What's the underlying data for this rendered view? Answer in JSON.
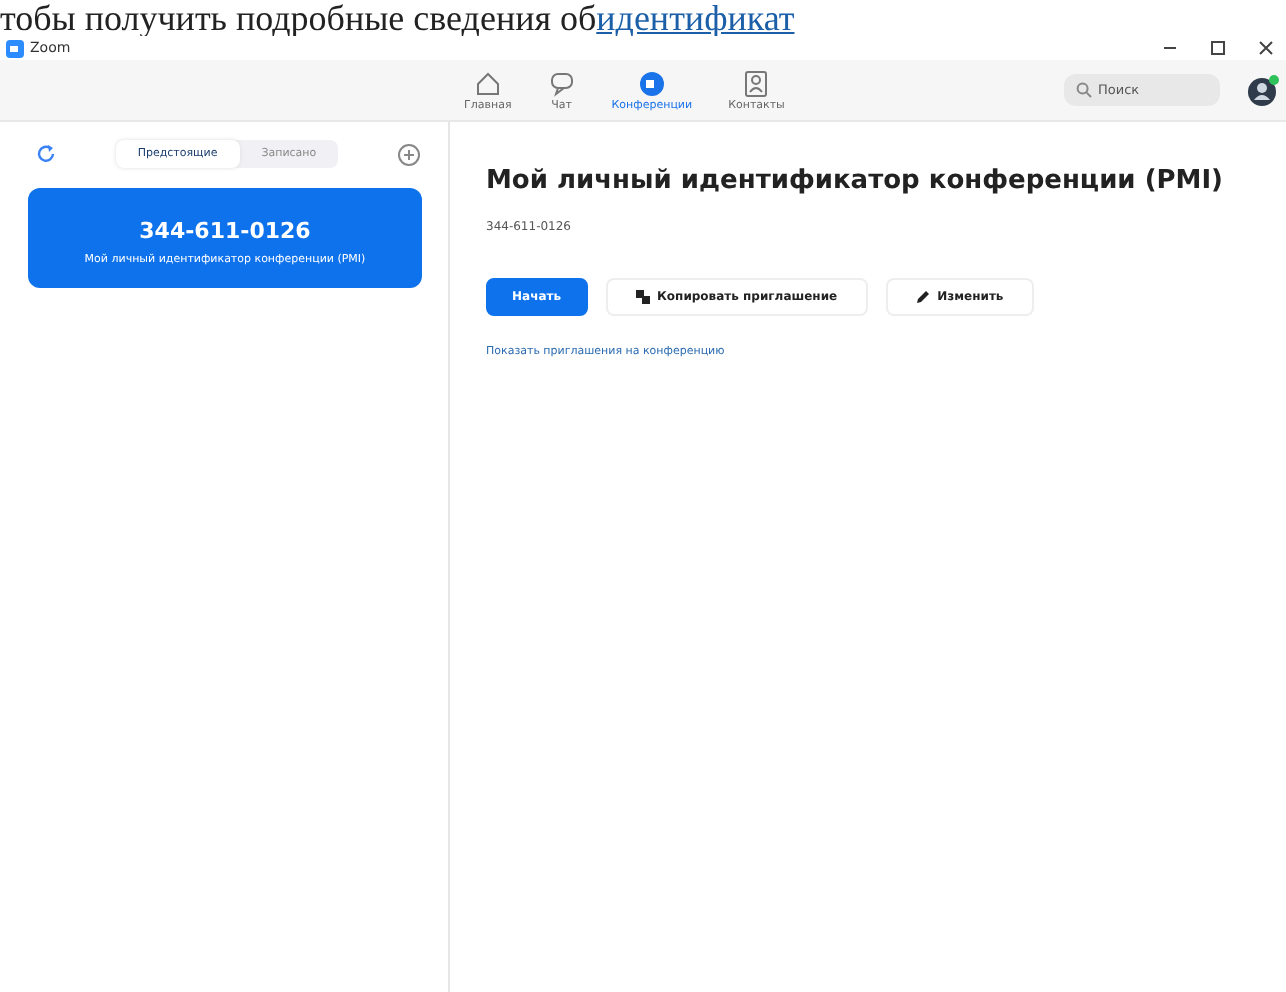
{
  "page_text": {
    "text": "тобы получить подробные сведения об",
    "link": "идентификат"
  },
  "window": {
    "title": "Zoom"
  },
  "nav_tabs": [
    {
      "kind": "home",
      "label": "Главная",
      "selected": false
    },
    {
      "kind": "chat",
      "label": "Чат",
      "selected": false
    },
    {
      "kind": "meetings",
      "label": "Конференции",
      "selected": true
    },
    {
      "kind": "contacts",
      "label": "Контакты",
      "selected": false
    }
  ],
  "search": {
    "placeholder": "Поиск"
  },
  "sidebar": {
    "tabs": [
      {
        "label": "Предстоящие",
        "selected": true
      },
      {
        "label": "Записано",
        "selected": false
      }
    ],
    "items": [
      {
        "number": "344-611-0126",
        "caption": "Мой личный идентификатор конференции (PMI)",
        "selected": true
      }
    ]
  },
  "detail": {
    "title": "Мой личный идентификатор конференции (PMI)",
    "number": "344-611-0126",
    "buttons": [
      {
        "kind": "primary",
        "label": "Начать"
      },
      {
        "kind": "copy",
        "label": "Копировать приглашение"
      },
      {
        "kind": "edit",
        "label": "Изменить"
      }
    ],
    "link": "Показать приглашения на конференцию"
  }
}
